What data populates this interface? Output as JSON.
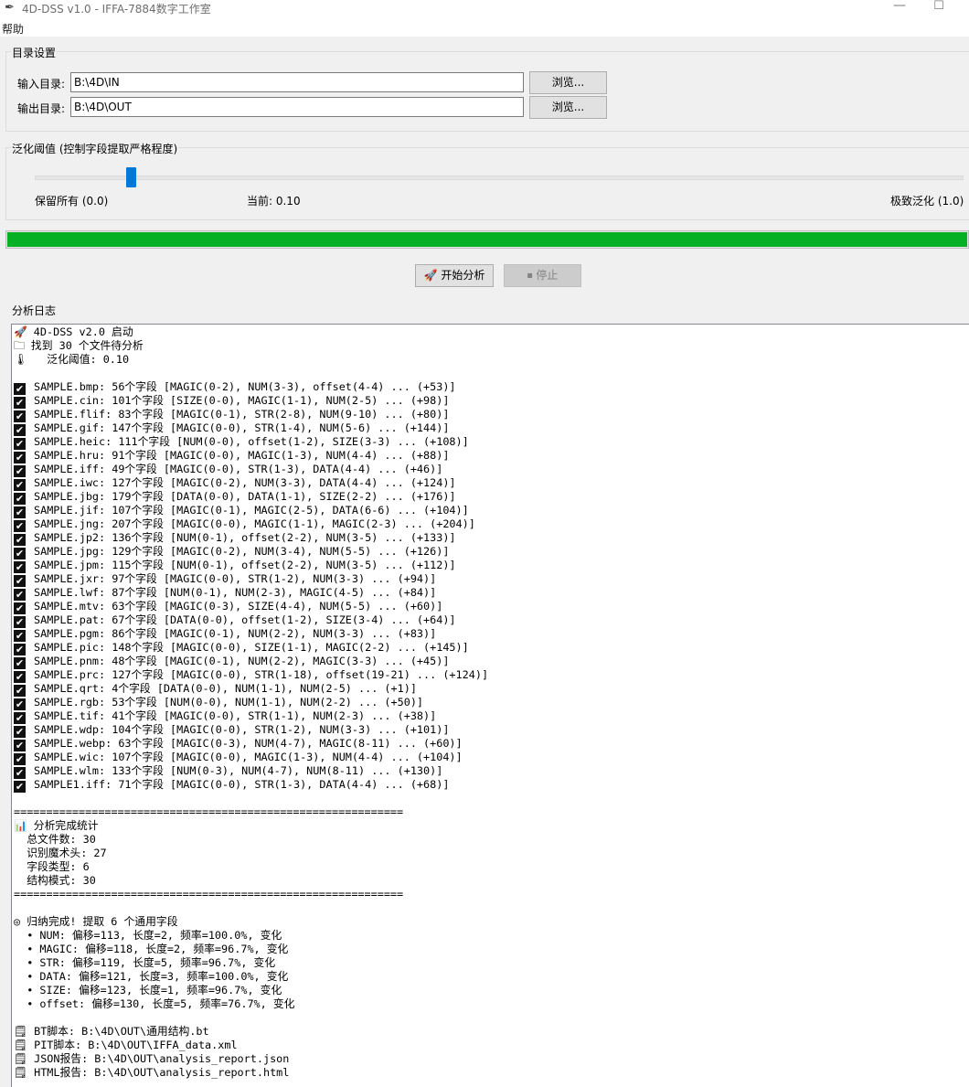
{
  "window": {
    "title": "4D-DSS v1.0 - IFFA-7884数字工作室",
    "icon": "feather-icon"
  },
  "menu": {
    "help": "帮助"
  },
  "dir_group": {
    "title": "目录设置",
    "input_label": "输入目录:",
    "input_value": "B:\\4D\\IN",
    "output_label": "输出目录:",
    "output_value": "B:\\4D\\OUT",
    "browse_label": "浏览..."
  },
  "threshold_group": {
    "title": "泛化阈值 (控制字段提取严格程度)",
    "min_label": "保留所有 (0.0)",
    "current_label": "当前: 0.10",
    "max_label": "极致泛化 (1.0)",
    "value": 0.1
  },
  "progress": {
    "percent": 100,
    "color": "#06b025"
  },
  "actions": {
    "start_label": "开始分析",
    "stop_label": "停止"
  },
  "log": {
    "title": "分析日志",
    "lines": [
      {
        "icon": "rocket-icon",
        "glyph": "🚀",
        "text": "4D-DSS v2.0 启动"
      },
      {
        "icon": "folder-icon",
        "glyph": "🗀",
        "text": "找到 30 个文件待分析"
      },
      {
        "icon": "gauge-icon",
        "glyph": "🌡",
        "text": "  泛化阈值: 0.10"
      },
      {
        "text": ""
      },
      {
        "check": true,
        "text": "SAMPLE.bmp: 56个字段 [MAGIC(0-2), NUM(3-3), offset(4-4) ... (+53)]"
      },
      {
        "check": true,
        "text": "SAMPLE.cin: 101个字段 [SIZE(0-0), MAGIC(1-1), NUM(2-5) ... (+98)]"
      },
      {
        "check": true,
        "text": "SAMPLE.flif: 83个字段 [MAGIC(0-1), STR(2-8), NUM(9-10) ... (+80)]"
      },
      {
        "check": true,
        "text": "SAMPLE.gif: 147个字段 [MAGIC(0-0), STR(1-4), NUM(5-6) ... (+144)]"
      },
      {
        "check": true,
        "text": "SAMPLE.heic: 111个字段 [NUM(0-0), offset(1-2), SIZE(3-3) ... (+108)]"
      },
      {
        "check": true,
        "text": "SAMPLE.hru: 91个字段 [MAGIC(0-0), MAGIC(1-3), NUM(4-4) ... (+88)]"
      },
      {
        "check": true,
        "text": "SAMPLE.iff: 49个字段 [MAGIC(0-0), STR(1-3), DATA(4-4) ... (+46)]"
      },
      {
        "check": true,
        "text": "SAMPLE.iwc: 127个字段 [MAGIC(0-2), NUM(3-3), DATA(4-4) ... (+124)]"
      },
      {
        "check": true,
        "text": "SAMPLE.jbg: 179个字段 [DATA(0-0), DATA(1-1), SIZE(2-2) ... (+176)]"
      },
      {
        "check": true,
        "text": "SAMPLE.jif: 107个字段 [MAGIC(0-1), MAGIC(2-5), DATA(6-6) ... (+104)]"
      },
      {
        "check": true,
        "text": "SAMPLE.jng: 207个字段 [MAGIC(0-0), MAGIC(1-1), MAGIC(2-3) ... (+204)]"
      },
      {
        "check": true,
        "text": "SAMPLE.jp2: 136个字段 [NUM(0-1), offset(2-2), NUM(3-5) ... (+133)]"
      },
      {
        "check": true,
        "text": "SAMPLE.jpg: 129个字段 [MAGIC(0-2), NUM(3-4), NUM(5-5) ... (+126)]"
      },
      {
        "check": true,
        "text": "SAMPLE.jpm: 115个字段 [NUM(0-1), offset(2-2), NUM(3-5) ... (+112)]"
      },
      {
        "check": true,
        "text": "SAMPLE.jxr: 97个字段 [MAGIC(0-0), STR(1-2), NUM(3-3) ... (+94)]"
      },
      {
        "check": true,
        "text": "SAMPLE.lwf: 87个字段 [NUM(0-1), NUM(2-3), MAGIC(4-5) ... (+84)]"
      },
      {
        "check": true,
        "text": "SAMPLE.mtv: 63个字段 [MAGIC(0-3), SIZE(4-4), NUM(5-5) ... (+60)]"
      },
      {
        "check": true,
        "text": "SAMPLE.pat: 67个字段 [DATA(0-0), offset(1-2), SIZE(3-4) ... (+64)]"
      },
      {
        "check": true,
        "text": "SAMPLE.pgm: 86个字段 [MAGIC(0-1), NUM(2-2), NUM(3-3) ... (+83)]"
      },
      {
        "check": true,
        "text": "SAMPLE.pic: 148个字段 [MAGIC(0-0), SIZE(1-1), MAGIC(2-2) ... (+145)]"
      },
      {
        "check": true,
        "text": "SAMPLE.pnm: 48个字段 [MAGIC(0-1), NUM(2-2), MAGIC(3-3) ... (+45)]"
      },
      {
        "check": true,
        "text": "SAMPLE.prc: 127个字段 [MAGIC(0-0), STR(1-18), offset(19-21) ... (+124)]"
      },
      {
        "check": true,
        "text": "SAMPLE.qrt: 4个字段 [DATA(0-0), NUM(1-1), NUM(2-5) ... (+1)]"
      },
      {
        "check": true,
        "text": "SAMPLE.rgb: 53个字段 [NUM(0-0), NUM(1-1), NUM(2-2) ... (+50)]"
      },
      {
        "check": true,
        "text": "SAMPLE.tif: 41个字段 [MAGIC(0-0), STR(1-1), NUM(2-3) ... (+38)]"
      },
      {
        "check": true,
        "text": "SAMPLE.wdp: 104个字段 [MAGIC(0-0), STR(1-2), NUM(3-3) ... (+101)]"
      },
      {
        "check": true,
        "text": "SAMPLE.webp: 63个字段 [MAGIC(0-3), NUM(4-7), MAGIC(8-11) ... (+60)]"
      },
      {
        "check": true,
        "text": "SAMPLE.wic: 107个字段 [MAGIC(0-0), MAGIC(1-3), NUM(4-4) ... (+104)]"
      },
      {
        "check": true,
        "text": "SAMPLE.wlm: 133个字段 [NUM(0-3), NUM(4-7), NUM(8-11) ... (+130)]"
      },
      {
        "check": true,
        "text": "SAMPLE1.iff: 71个字段 [MAGIC(0-0), STR(1-3), DATA(4-4) ... (+68)]"
      },
      {
        "text": ""
      },
      {
        "text": "============================================================"
      },
      {
        "icon": "bar-chart-icon",
        "glyph": "📊",
        "text": "分析完成统计"
      },
      {
        "text": "  总文件数: 30"
      },
      {
        "text": "  识别魔术头: 27"
      },
      {
        "text": "  字段类型: 6"
      },
      {
        "text": "  结构模式: 30"
      },
      {
        "text": "============================================================"
      },
      {
        "text": ""
      },
      {
        "icon": "target-icon",
        "glyph": "◎",
        "text": "归纳完成! 提取 6 个通用字段"
      },
      {
        "text": "  • NUM: 偏移=113, 长度=2, 频率=100.0%, 变化"
      },
      {
        "text": "  • MAGIC: 偏移=118, 长度=2, 频率=96.7%, 变化"
      },
      {
        "text": "  • STR: 偏移=119, 长度=5, 频率=96.7%, 变化"
      },
      {
        "text": "  • DATA: 偏移=121, 长度=3, 频率=100.0%, 变化"
      },
      {
        "text": "  • SIZE: 偏移=123, 长度=1, 频率=96.7%, 变化"
      },
      {
        "text": "  • offset: 偏移=130, 长度=5, 频率=76.7%, 变化"
      },
      {
        "text": ""
      },
      {
        "icon": "document-icon",
        "glyph": "🗒",
        "text": "BT脚本: B:\\4D\\OUT\\通用结构.bt"
      },
      {
        "icon": "document-icon",
        "glyph": "🗒",
        "text": "PIT脚本: B:\\4D\\OUT\\IFFA_data.xml"
      },
      {
        "icon": "document-icon",
        "glyph": "🗒",
        "text": "JSON报告: B:\\4D\\OUT\\analysis_report.json"
      },
      {
        "icon": "document-icon",
        "glyph": "🗒",
        "text": "HTML报告: B:\\4D\\OUT\\analysis_report.html"
      }
    ]
  }
}
